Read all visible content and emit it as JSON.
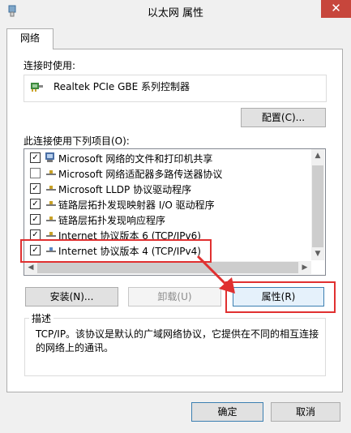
{
  "window": {
    "title": "以太网 属性",
    "close_label": "✕",
    "app_icon": "network-adapter-icon"
  },
  "tabs": [
    {
      "label": "网络",
      "selected": true
    }
  ],
  "connection": {
    "label": "连接时使用:",
    "adapter_name": "Realtek PCIe GBE 系列控制器",
    "configure_label": "配置(C)..."
  },
  "items": {
    "label": "此连接使用下列项目(O):",
    "rows": [
      {
        "text": "Microsoft 网络的文件和打印机共享",
        "checked": true,
        "icon": "printer-share-icon"
      },
      {
        "text": "Microsoft 网络适配器多路传送器协议",
        "checked": false,
        "icon": "protocol-icon"
      },
      {
        "text": "Microsoft LLDP 协议驱动程序",
        "checked": true,
        "icon": "protocol-icon"
      },
      {
        "text": "链路层拓扑发现映射器 I/O 驱动程序",
        "checked": true,
        "icon": "protocol-icon"
      },
      {
        "text": "链路层拓扑发现响应程序",
        "checked": true,
        "icon": "protocol-icon"
      },
      {
        "text": "Internet 协议版本 6 (TCP/IPv6)",
        "checked": true,
        "icon": "protocol-icon"
      },
      {
        "text": "Internet 协议版本 4 (TCP/IPv4)",
        "checked": true,
        "icon": "protocol-icon"
      }
    ]
  },
  "buttons": {
    "install": "安装(N)...",
    "uninstall": "卸载(U)",
    "properties": "属性(R)",
    "ok": "确定",
    "cancel": "取消"
  },
  "description": {
    "label": "描述",
    "text": "TCP/IP。该协议是默认的广域网络协议，它提供在不同的相互连接的网络上的通讯。"
  },
  "colors": {
    "highlight_red": "#e03030",
    "close_red": "#c7463c"
  }
}
